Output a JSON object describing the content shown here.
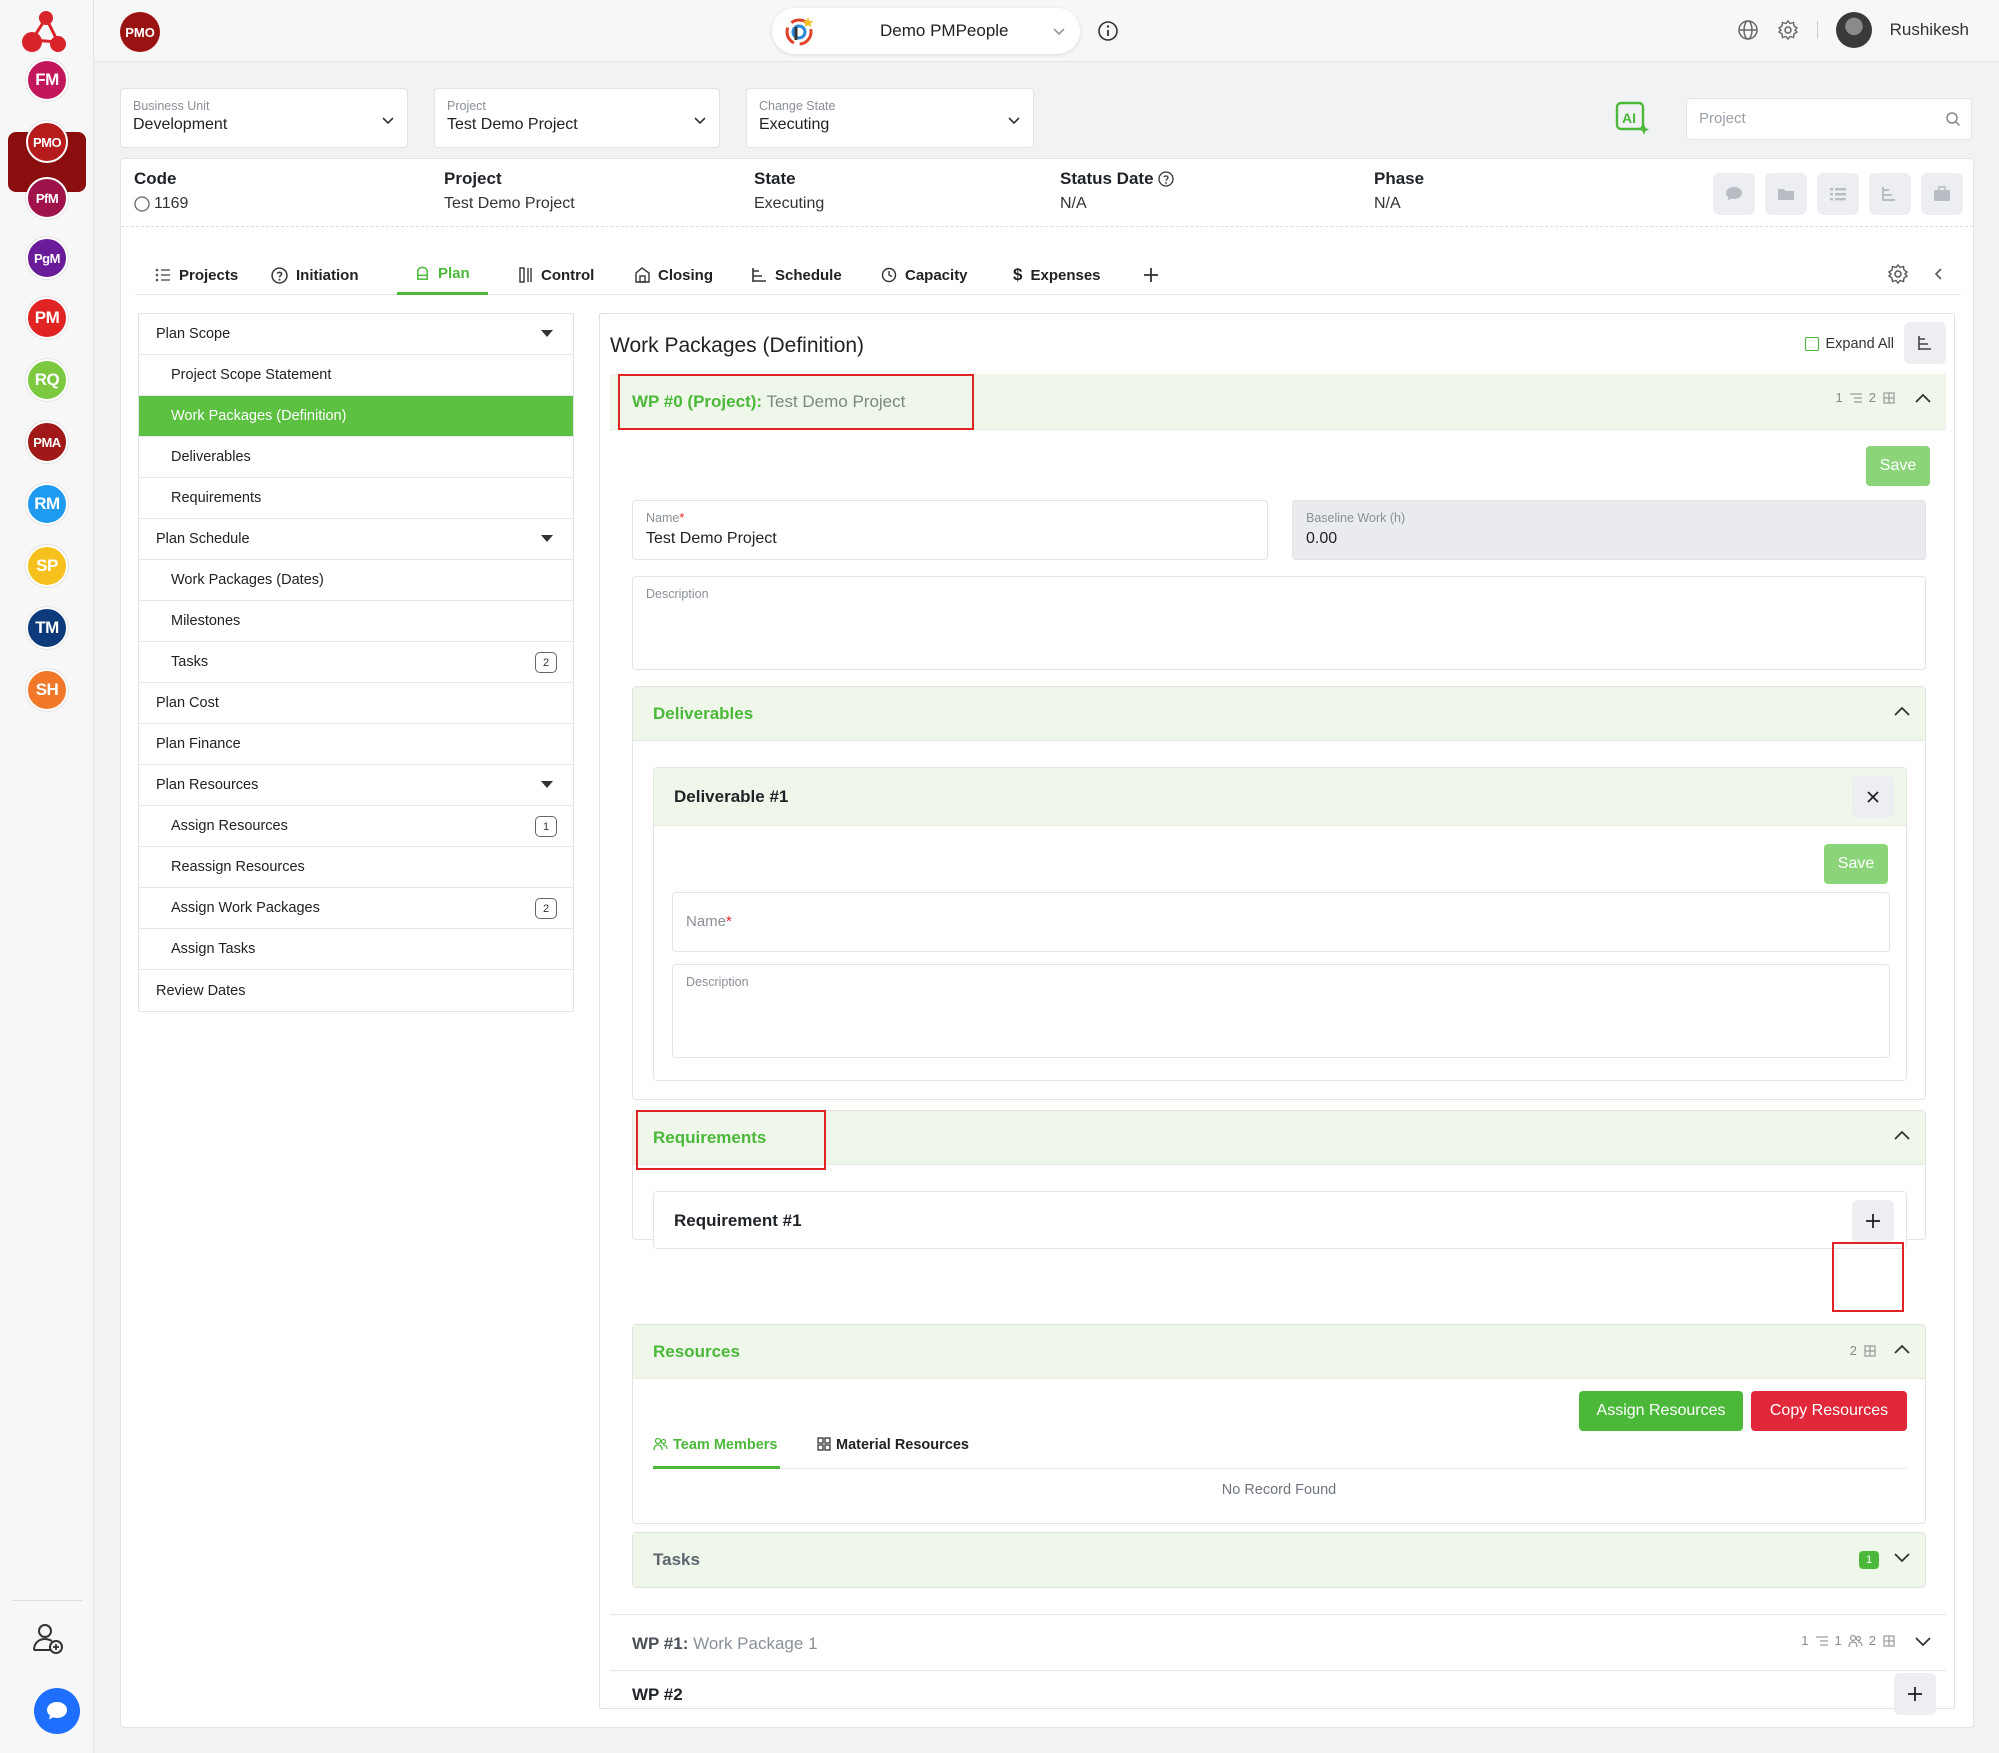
{
  "rail": {
    "items": [
      {
        "abbr": "FM",
        "color": "#c2185b"
      },
      {
        "abbr": "PMO",
        "color": "#b71c1c"
      },
      {
        "abbr": "PfM",
        "color": "#a0124a"
      },
      {
        "abbr": "PgM",
        "color": "#6a1b9a"
      },
      {
        "abbr": "PM",
        "color": "#e02424"
      },
      {
        "abbr": "RQ",
        "color": "#7cc83e"
      },
      {
        "abbr": "PMA",
        "color": "#a01818"
      },
      {
        "abbr": "RM",
        "color": "#1e9bf0"
      },
      {
        "abbr": "SP",
        "color": "#f6c11c"
      },
      {
        "abbr": "TM",
        "color": "#0d3a7a"
      },
      {
        "abbr": "SH",
        "color": "#f07828"
      }
    ]
  },
  "topbar": {
    "module_badge": "PMO",
    "org_name": "Demo PMPeople",
    "username": "Rushikesh"
  },
  "filters": {
    "business_unit": {
      "label": "Business Unit",
      "value": "Development"
    },
    "project": {
      "label": "Project",
      "value": "Test Demo Project"
    },
    "change_state": {
      "label": "Change State",
      "value": "Executing"
    },
    "search_placeholder": "Project"
  },
  "info": {
    "code": {
      "label": "Code",
      "value": "1169"
    },
    "project": {
      "label": "Project",
      "value": "Test Demo Project"
    },
    "state": {
      "label": "State",
      "value": "Executing"
    },
    "status_date": {
      "label": "Status Date",
      "value": "N/A"
    },
    "phase": {
      "label": "Phase",
      "value": "N/A"
    }
  },
  "tabs": [
    {
      "label": "Projects",
      "icon": "list-icon"
    },
    {
      "label": "Initiation",
      "icon": "question-circle-icon"
    },
    {
      "label": "Plan",
      "icon": "plan-icon"
    },
    {
      "label": "Control",
      "icon": "control-icon"
    },
    {
      "label": "Closing",
      "icon": "closing-icon"
    },
    {
      "label": "Schedule",
      "icon": "schedule-icon"
    },
    {
      "label": "Capacity",
      "icon": "clock-icon"
    },
    {
      "label": "Expenses",
      "icon": "dollar-icon"
    }
  ],
  "leftnav": {
    "items": [
      {
        "label": "Plan Scope",
        "level": 0,
        "caret": true
      },
      {
        "label": "Project Scope Statement",
        "level": 1
      },
      {
        "label": "Work Packages (Definition)",
        "level": 1,
        "active": true
      },
      {
        "label": "Deliverables",
        "level": 1
      },
      {
        "label": "Requirements",
        "level": 1
      },
      {
        "label": "Plan Schedule",
        "level": 0,
        "caret": true
      },
      {
        "label": "Work Packages (Dates)",
        "level": 1
      },
      {
        "label": "Milestones",
        "level": 1
      },
      {
        "label": "Tasks",
        "level": 1,
        "badge": "2"
      },
      {
        "label": "Plan Cost",
        "level": 0
      },
      {
        "label": "Plan Finance",
        "level": 0
      },
      {
        "label": "Plan Resources",
        "level": 0,
        "caret": true
      },
      {
        "label": "Assign Resources",
        "level": 1,
        "badge": "1"
      },
      {
        "label": "Reassign Resources",
        "level": 1
      },
      {
        "label": "Assign Work Packages",
        "level": 1,
        "badge": "2"
      },
      {
        "label": "Assign Tasks",
        "level": 1
      },
      {
        "label": "Review Dates",
        "level": 0
      }
    ]
  },
  "content": {
    "title": "Work Packages (Definition)",
    "expand_all": "Expand All",
    "wp0": {
      "prefix": "WP #0 (Project):",
      "name": "Test Demo Project",
      "meta_a": "1",
      "meta_b": "2",
      "save": "Save",
      "name_field": {
        "label": "Name",
        "value": "Test Demo Project"
      },
      "baseline_field": {
        "label": "Baseline Work (h)",
        "value": "0.00"
      },
      "description_label": "Description"
    },
    "deliverables": {
      "title": "Deliverables",
      "card_title": "Deliverable #1",
      "save": "Save",
      "name_label": "Name",
      "description_label": "Description"
    },
    "requirements": {
      "title": "Requirements",
      "card_title": "Requirement #1"
    },
    "resources": {
      "title": "Resources",
      "count": "2",
      "assign_btn": "Assign Resources",
      "copy_btn": "Copy Resources",
      "tab_team": "Team Members",
      "tab_material": "Material Resources",
      "empty": "No Record Found"
    },
    "tasks": {
      "title": "Tasks",
      "count": "1"
    },
    "wp1": {
      "prefix": "WP #1:",
      "name": "Work Package 1",
      "meta_a": "1",
      "meta_b": "1",
      "meta_c": "2"
    },
    "wp2": {
      "prefix": "WP #2"
    }
  },
  "colors": {
    "accent": "#4bb83a",
    "danger": "#e02424",
    "active_nav": "#5cc041"
  }
}
